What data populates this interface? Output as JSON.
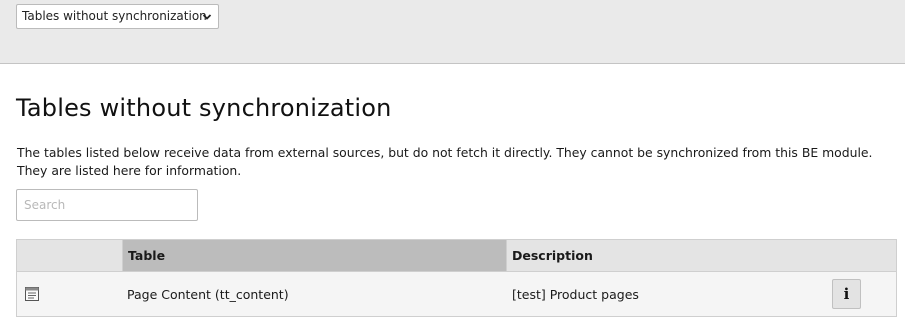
{
  "docheader": {
    "view_select": {
      "selected": "Tables without synchronization"
    }
  },
  "main": {
    "title": "Tables without synchronization",
    "intro": "The tables listed below receive data from external sources, but do not fetch it directly. They cannot be synchronized from this BE module. They are listed here for information.",
    "search": {
      "placeholder": "Search",
      "value": ""
    },
    "table": {
      "columns": [
        "",
        "Table",
        "Description"
      ],
      "rows": [
        {
          "icon": "content-element-icon",
          "table": "Page Content (tt_content)",
          "description": "[test] Product pages",
          "action_icon": "info-icon",
          "action_label": "i"
        }
      ]
    }
  }
}
